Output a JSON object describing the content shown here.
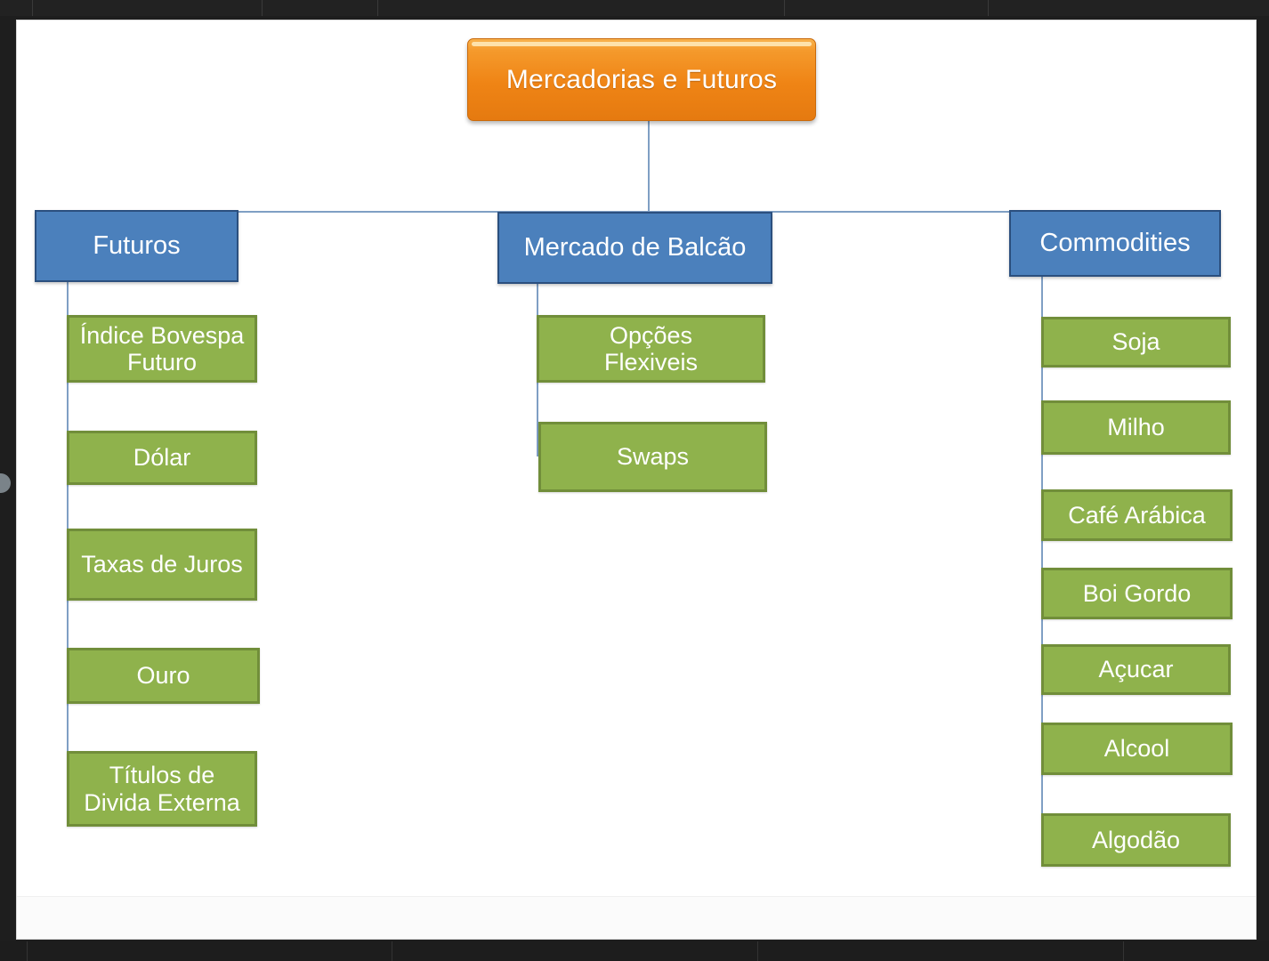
{
  "chrome": {
    "left_handle": "drag-handle"
  },
  "diagram": {
    "type": "organizational-tree",
    "colors": {
      "root_fill": "#ef8415",
      "root_border": "#c96a0c",
      "level2_fill": "#4b80bc",
      "level2_border": "#2b4f7e",
      "level3_fill": "#8fb24c",
      "level3_border": "#718e3a",
      "connector": "#7f9fc4",
      "canvas": "#ffffff",
      "chrome": "#1e1e1e"
    },
    "root": {
      "label": "Mercadorias e Futuros"
    },
    "branches": [
      {
        "label": "Futuros",
        "children": [
          {
            "label": "Índice Bovespa\nFuturo"
          },
          {
            "label": "Dólar"
          },
          {
            "label": "Taxas de Juros"
          },
          {
            "label": "Ouro"
          },
          {
            "label": "Títulos de\nDivida Externa"
          }
        ]
      },
      {
        "label": "Mercado de Balcão",
        "children": [
          {
            "label": "Opções\nFlexiveis"
          },
          {
            "label": "Swaps"
          }
        ]
      },
      {
        "label": "Commodities",
        "children": [
          {
            "label": "Soja"
          },
          {
            "label": "Milho"
          },
          {
            "label": "Café Arábica"
          },
          {
            "label": "Boi Gordo"
          },
          {
            "label": "Açucar"
          },
          {
            "label": "Alcool"
          },
          {
            "label": "Algodão"
          }
        ]
      }
    ]
  }
}
